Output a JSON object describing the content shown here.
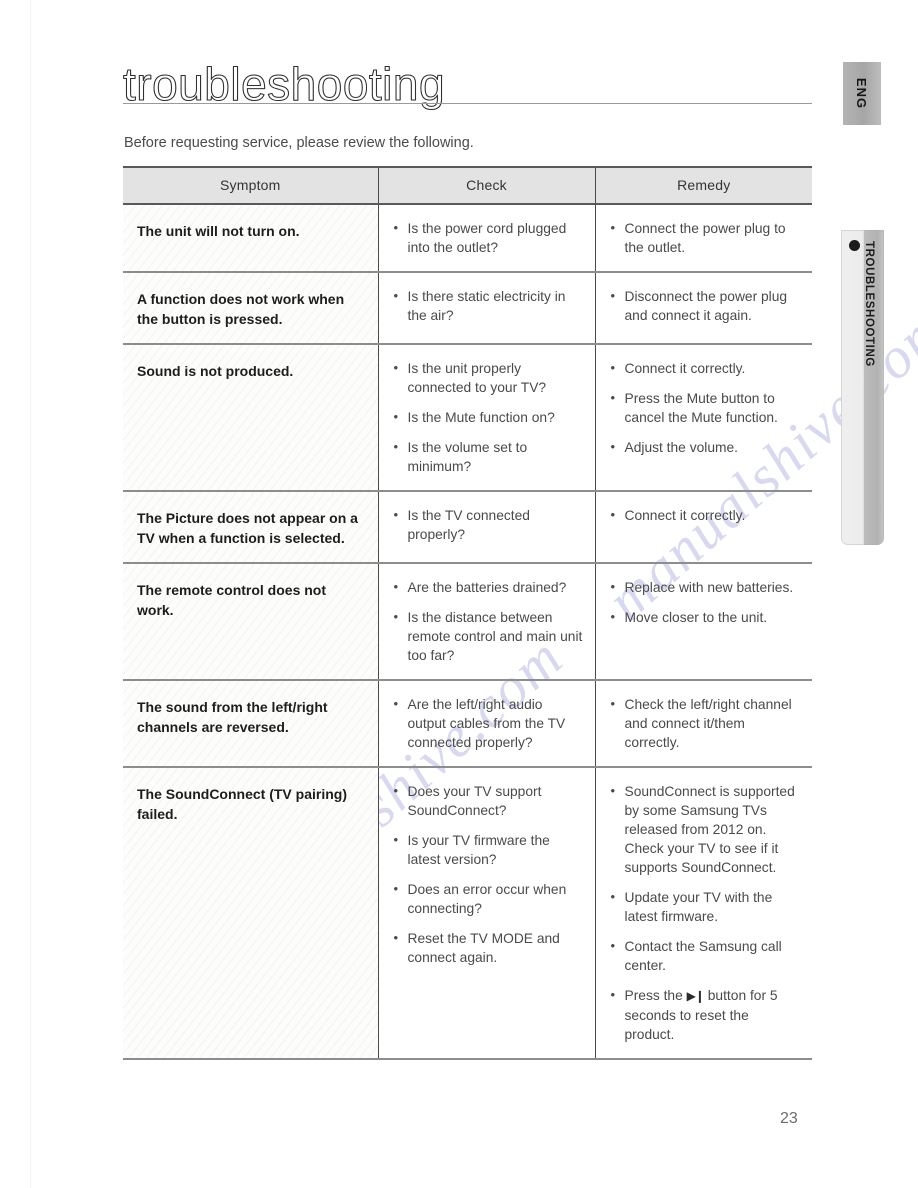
{
  "page": {
    "title": "troubleshooting",
    "intro": "Before requesting service, please review the following.",
    "page_number": "23",
    "watermark": "manualshive.com"
  },
  "side_tabs": {
    "language": "ENG",
    "section": "TROUBLESHOOTING"
  },
  "table": {
    "headers": [
      "Symptom",
      "Check",
      "Remedy"
    ],
    "rows": [
      {
        "symptom": "The unit will not turn on.",
        "check": [
          "Is the power cord plugged into the outlet?"
        ],
        "remedy": [
          "Connect the power plug to the outlet."
        ]
      },
      {
        "symptom": "A function does not work when the button is pressed.",
        "check": [
          "Is there static electricity in the air?"
        ],
        "remedy": [
          "Disconnect the power plug and connect it again."
        ]
      },
      {
        "symptom": "Sound is not produced.",
        "check": [
          "Is the unit properly connected to your TV?",
          "Is the Mute function on?",
          "Is the volume set to minimum?"
        ],
        "remedy": [
          "Connect it correctly.",
          "Press the Mute button to cancel the Mute function.",
          "Adjust the volume."
        ]
      },
      {
        "symptom": "The Picture does not appear on a TV when a function is selected.",
        "check": [
          "Is the TV connected properly?"
        ],
        "remedy": [
          "Connect it correctly."
        ]
      },
      {
        "symptom": "The remote control does not work.",
        "check": [
          "Are the batteries drained?",
          "Is the distance between remote control and main unit too far?"
        ],
        "remedy": [
          "Replace with new batteries.",
          "Move closer to the unit."
        ]
      },
      {
        "symptom": "The sound from the left/right channels are reversed.",
        "check": [
          "Are the left/right audio output cables from the TV connected properly?"
        ],
        "remedy": [
          "Check the left/right channel and connect it/them correctly."
        ]
      },
      {
        "symptom": "The SoundConnect (TV pairing) failed.",
        "check": [
          "Does your TV support SoundConnect?",
          "Is your TV firmware the latest version?",
          "Does an error occur when connecting?",
          "Reset the TV MODE and connect again."
        ],
        "remedy": [
          "SoundConnect is supported by some Samsung TVs released from 2012 on. Check your TV to see if it supports SoundConnect.",
          "Update your TV with the latest firmware.",
          "Contact the Samsung call center.",
          {
            "before": "Press the ",
            "glyph": "▶❙",
            "after": " button for 5 seconds to reset the product."
          }
        ]
      }
    ]
  }
}
